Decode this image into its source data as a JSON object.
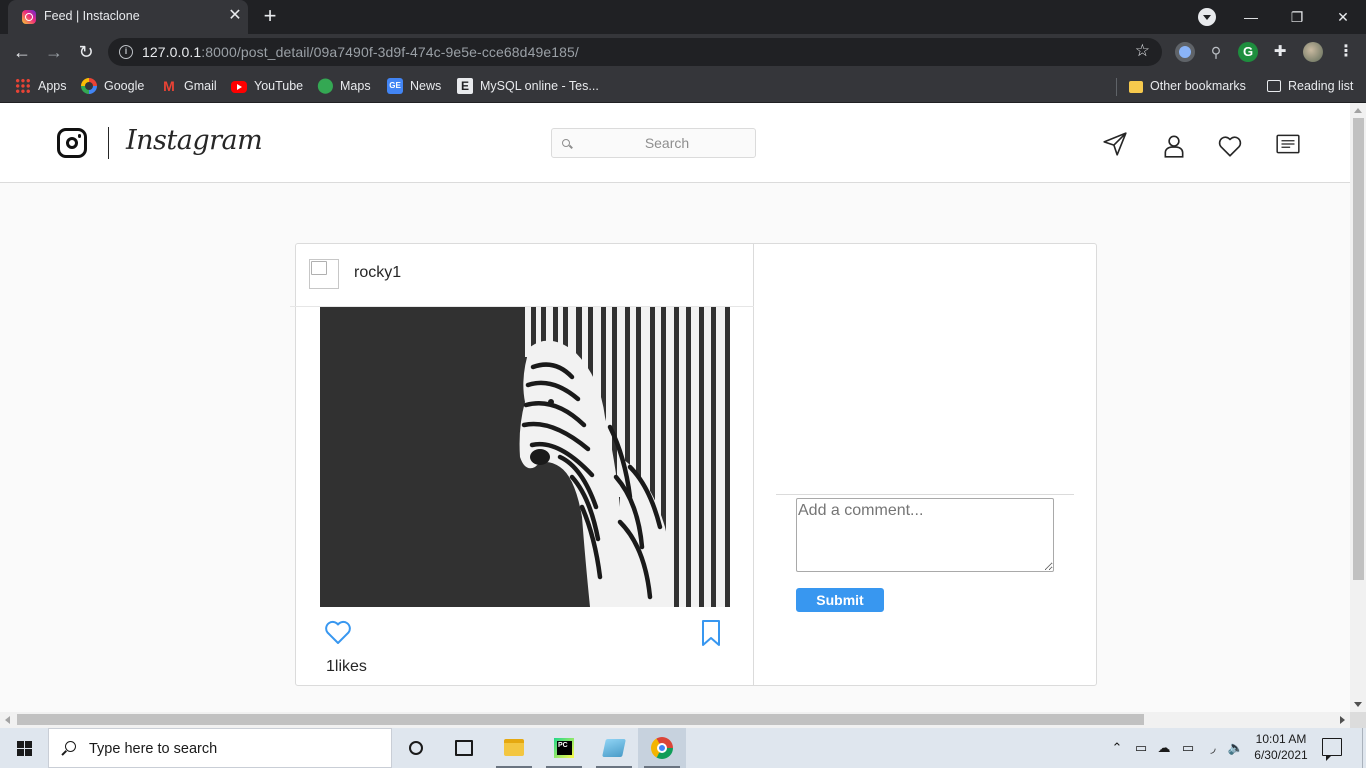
{
  "browser": {
    "tab_title": "Feed | Instaclone",
    "tab_close": "✕",
    "new_tab": "+",
    "url_host": "127.0.0.1",
    "url_rest": ":8000/post_detail/09a7490f-3d9f-474c-9e5e-cce68d49e185/",
    "window_minimize": "—",
    "window_restore": "❐",
    "window_close": "✕",
    "back": "←",
    "forward": "→",
    "reload": "↻",
    "star": "☆",
    "bookmarks": [
      {
        "label": "Apps",
        "icon": "apps-grid-icon"
      },
      {
        "label": "Google",
        "icon": "google-icon"
      },
      {
        "label": "Gmail",
        "icon": "gmail-icon"
      },
      {
        "label": "YouTube",
        "icon": "youtube-icon"
      },
      {
        "label": "Maps",
        "icon": "maps-pin-icon"
      },
      {
        "label": "News",
        "icon": "google-news-icon"
      },
      {
        "label": "MySQL online - Tes...",
        "icon": "e-letter-icon"
      }
    ],
    "other_bookmarks": "Other bookmarks",
    "reading_list": "Reading list"
  },
  "app": {
    "wordmark": "Instagram",
    "search_placeholder": "Search",
    "nav_icons": [
      "send-icon",
      "profile-icon",
      "heart-icon",
      "feed-icon"
    ]
  },
  "post": {
    "username": "rocky1",
    "image_description": "black and white zebra striped artwork",
    "likes_count": 1,
    "likes_text": "1likes",
    "comment_placeholder": "Add a comment...",
    "submit_label": "Submit"
  },
  "taskbar": {
    "search_text": "Type here to search",
    "time": "10:01 AM",
    "date": "6/30/2021",
    "apps": [
      "cortana-icon",
      "task-view-icon",
      "file-explorer-icon",
      "pycharm-icon",
      "notes-app-icon",
      "chrome-icon"
    ]
  },
  "colors": {
    "accent": "#3897f0",
    "browser_dark": "#202124",
    "browser_toolbar": "#35363a"
  }
}
